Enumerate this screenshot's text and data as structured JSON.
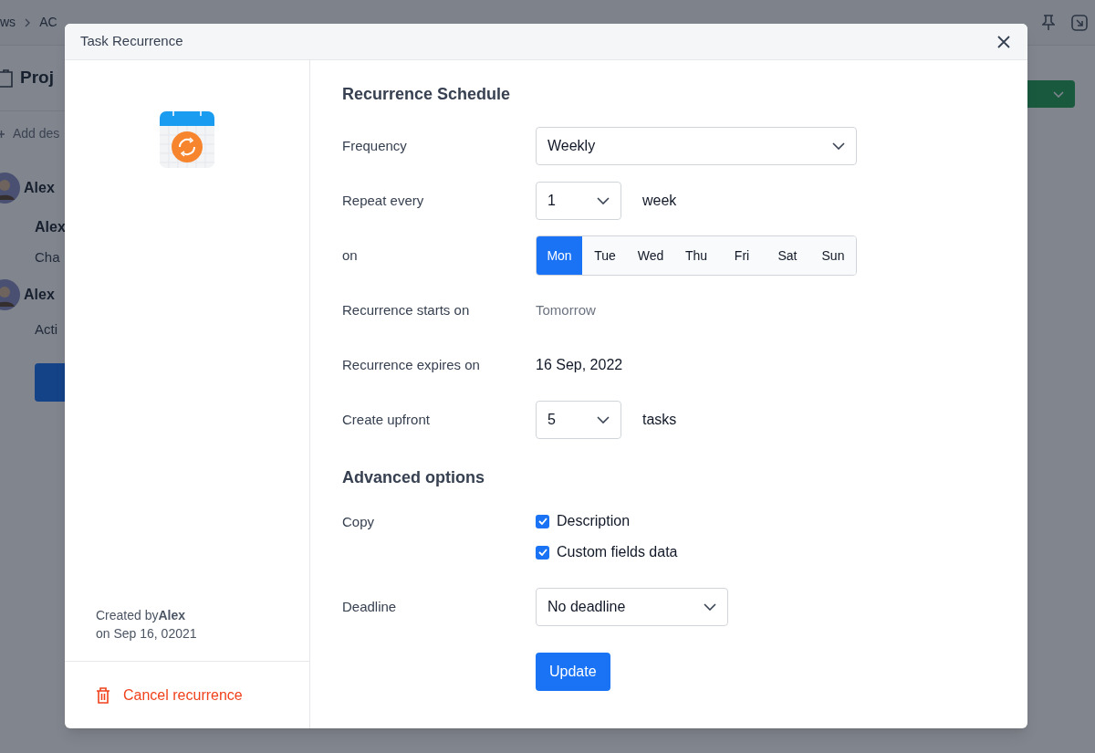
{
  "background": {
    "breadcrumb": [
      "ws",
      "AC"
    ],
    "page_title": "Proj",
    "add_description": "Add des",
    "feed": [
      {
        "kind": "avatar_name",
        "text": "Alex"
      },
      {
        "kind": "bold",
        "text": "Alex"
      },
      {
        "kind": "plain",
        "text": "Cha"
      },
      {
        "kind": "avatar_name",
        "text": "Alex"
      },
      {
        "kind": "plain",
        "text": "Acti"
      }
    ]
  },
  "dialog": {
    "title": "Task Recurrence",
    "sidebar": {
      "created_by_label": "Created by",
      "created_by_name": "Alex",
      "created_on": "on Sep 16, 02021",
      "cancel_button": "Cancel recurrence"
    },
    "schedule_heading": "Recurrence Schedule",
    "schedule": [
      {
        "kind": "select",
        "label": "Frequency",
        "value": "Weekly"
      },
      {
        "kind": "number_select",
        "label": "Repeat every",
        "value": "1",
        "unit": "week"
      },
      {
        "kind": "days",
        "label": "on",
        "days": [
          {
            "label": "Mon",
            "selected": true
          },
          {
            "label": "Tue",
            "selected": false
          },
          {
            "label": "Wed",
            "selected": false
          },
          {
            "label": "Thu",
            "selected": false
          },
          {
            "label": "Fri",
            "selected": false
          },
          {
            "label": "Sat",
            "selected": false
          },
          {
            "label": "Sun",
            "selected": false
          }
        ]
      },
      {
        "kind": "muted_text",
        "label": "Recurrence starts on",
        "value": "Tomorrow"
      },
      {
        "kind": "text",
        "label": "Recurrence expires on",
        "value": "16 Sep, 2022"
      },
      {
        "kind": "number_select",
        "label": "Create upfront",
        "value": "5",
        "unit": "tasks"
      }
    ],
    "advanced_heading": "Advanced options",
    "copy": {
      "label": "Copy",
      "options": [
        {
          "label": "Description",
          "checked": true
        },
        {
          "label": "Custom fields data",
          "checked": true
        }
      ]
    },
    "deadline": {
      "label": "Deadline",
      "value": "No deadline"
    },
    "update_button": "Update"
  }
}
